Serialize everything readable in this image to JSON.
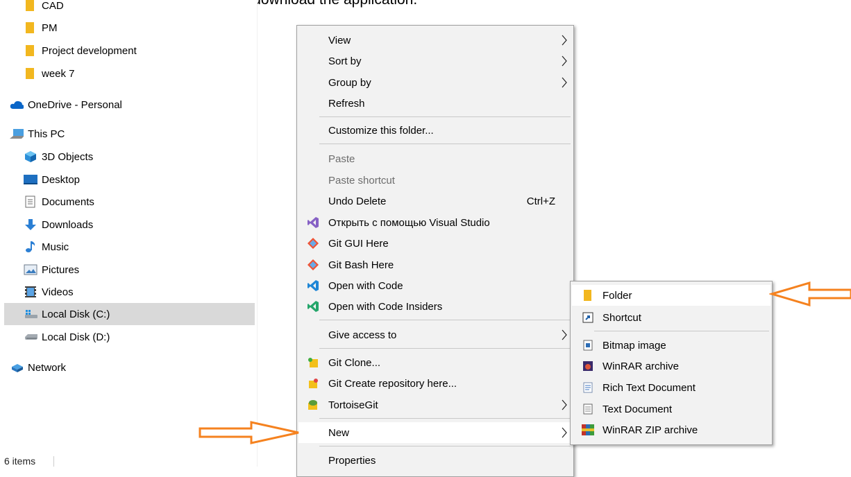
{
  "caption": "Create new folder on your computer to download the application.",
  "nav": {
    "items": [
      {
        "label": "CAD",
        "icon": "folder-icon"
      },
      {
        "label": "PM",
        "icon": "folder-icon"
      },
      {
        "label": "Project development",
        "icon": "folder-icon"
      },
      {
        "label": "week 7",
        "icon": "folder-icon"
      },
      {
        "label": "OneDrive - Personal",
        "icon": "cloud-icon"
      },
      {
        "label": "This PC",
        "icon": "computer-icon"
      },
      {
        "label": "3D Objects",
        "icon": "cube-icon"
      },
      {
        "label": "Desktop",
        "icon": "desktop-icon"
      },
      {
        "label": "Documents",
        "icon": "document-icon"
      },
      {
        "label": "Downloads",
        "icon": "download-arrow-icon"
      },
      {
        "label": "Music",
        "icon": "music-note-icon"
      },
      {
        "label": "Pictures",
        "icon": "picture-icon"
      },
      {
        "label": "Videos",
        "icon": "film-icon"
      },
      {
        "label": "Local Disk (C:)",
        "icon": "windows-disk-icon",
        "selected": true
      },
      {
        "label": "Local Disk (D:)",
        "icon": "disk-icon"
      },
      {
        "label": "Network",
        "icon": "network-icon"
      }
    ],
    "status": "6 items"
  },
  "context_menu": {
    "view": "View",
    "sort_by": "Sort by",
    "group_by": "Group by",
    "refresh": "Refresh",
    "customize": "Customize this folder...",
    "paste": "Paste",
    "paste_shortcut": "Paste shortcut",
    "undo_delete": "Undo Delete",
    "undo_shortcut": "Ctrl+Z",
    "open_vs": "Открыть с помощью Visual Studio",
    "git_gui": "Git GUI Here",
    "git_bash": "Git Bash Here",
    "open_code": "Open with Code",
    "open_code_insiders": "Open with Code Insiders",
    "give_access": "Give access to",
    "git_clone": "Git Clone...",
    "git_create_repo": "Git Create repository here...",
    "tortoisegit": "TortoiseGit",
    "new": "New",
    "properties": "Properties"
  },
  "new_submenu": {
    "folder": "Folder",
    "shortcut": "Shortcut",
    "bitmap": "Bitmap image",
    "winrar": "WinRAR archive",
    "rtf": "Rich Text Document",
    "text": "Text Document",
    "winrar_zip": "WinRAR ZIP archive"
  },
  "colors": {
    "arrow": "#f5821f",
    "highlight": "#ffffff",
    "menu_bg": "#f2f2f2",
    "selected": "#d9d9d9"
  }
}
